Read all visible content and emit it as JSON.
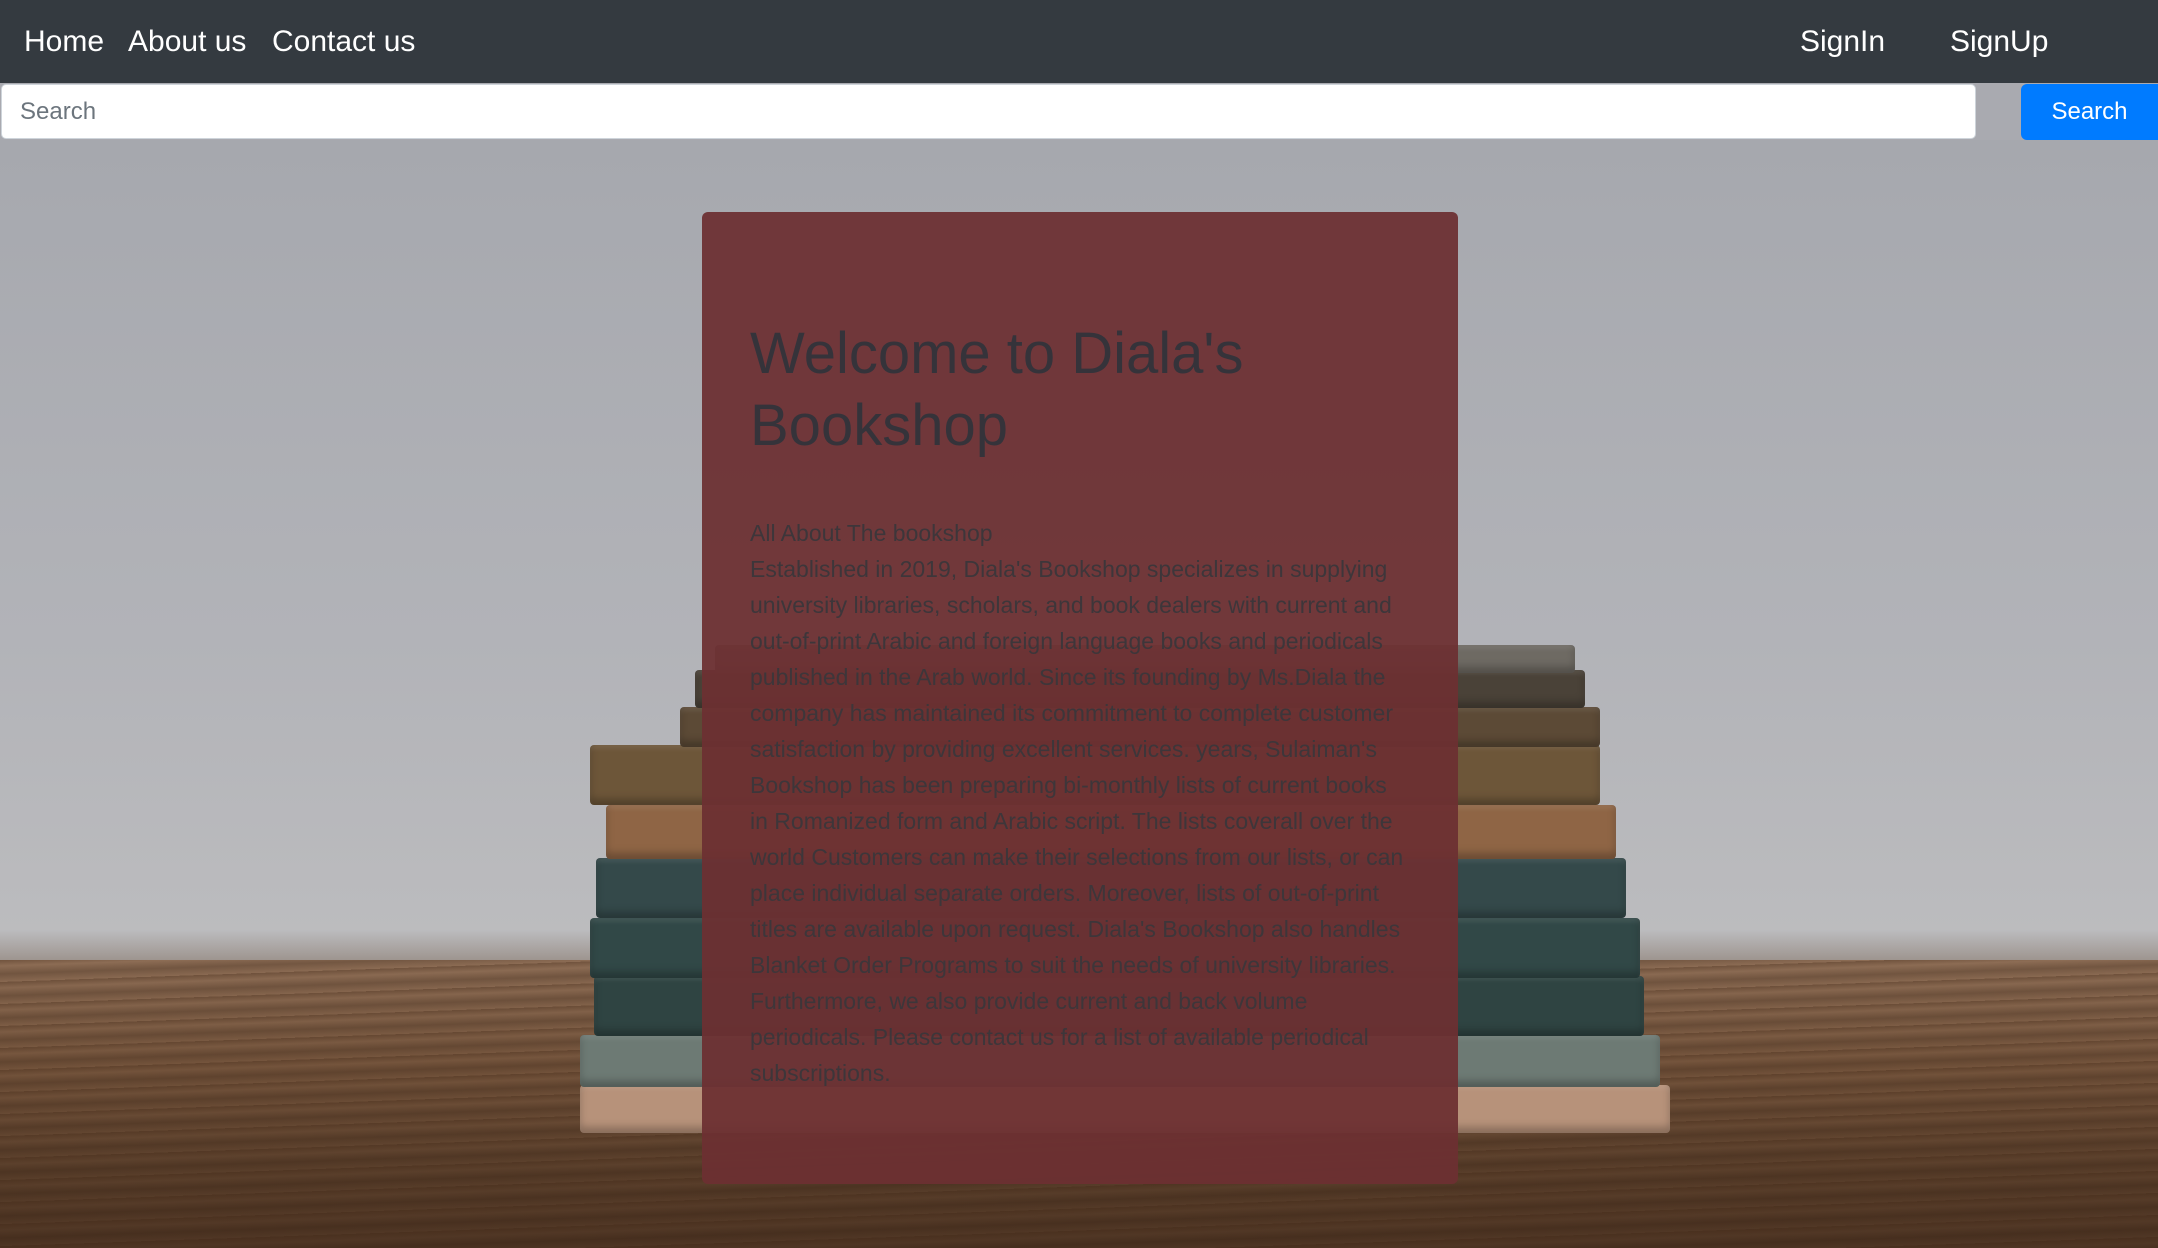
{
  "nav": {
    "home": "Home",
    "about": "About us",
    "contact": "Contact us",
    "signin": "SignIn",
    "signup": "SignUp"
  },
  "search": {
    "placeholder": "Search",
    "button_label": "Search"
  },
  "card": {
    "title": "Welcome to Diala's Bookshop",
    "subtitle": "All About The bookshop",
    "body": "Established in 2019, Diala's Bookshop specializes in supplying university libraries, scholars, and book dealers with current and out-of-print Arabic and foreign language books and periodicals published in the Arab world. Since its founding by Ms.Diala the company has maintained its commitment to complete customer satisfaction by providing excellent services. years, Sulaiman's Bookshop has been preparing bi-monthly lists of current books in Romanized form and Arabic script. The lists coverall over the world Customers can make their selections from our lists, or can place individual separate orders. Moreover, lists of out-of-print titles are available upon request. Diala's Bookshop also handles Blanket Order Programs to suit the needs of university libraries. Furthermore, we also provide current and back volume periodicals. Please contact us for a list of available periodical subscriptions."
  },
  "colors": {
    "navbar": "#343a40",
    "primary_button": "#007bff",
    "card": "#6c3032"
  }
}
